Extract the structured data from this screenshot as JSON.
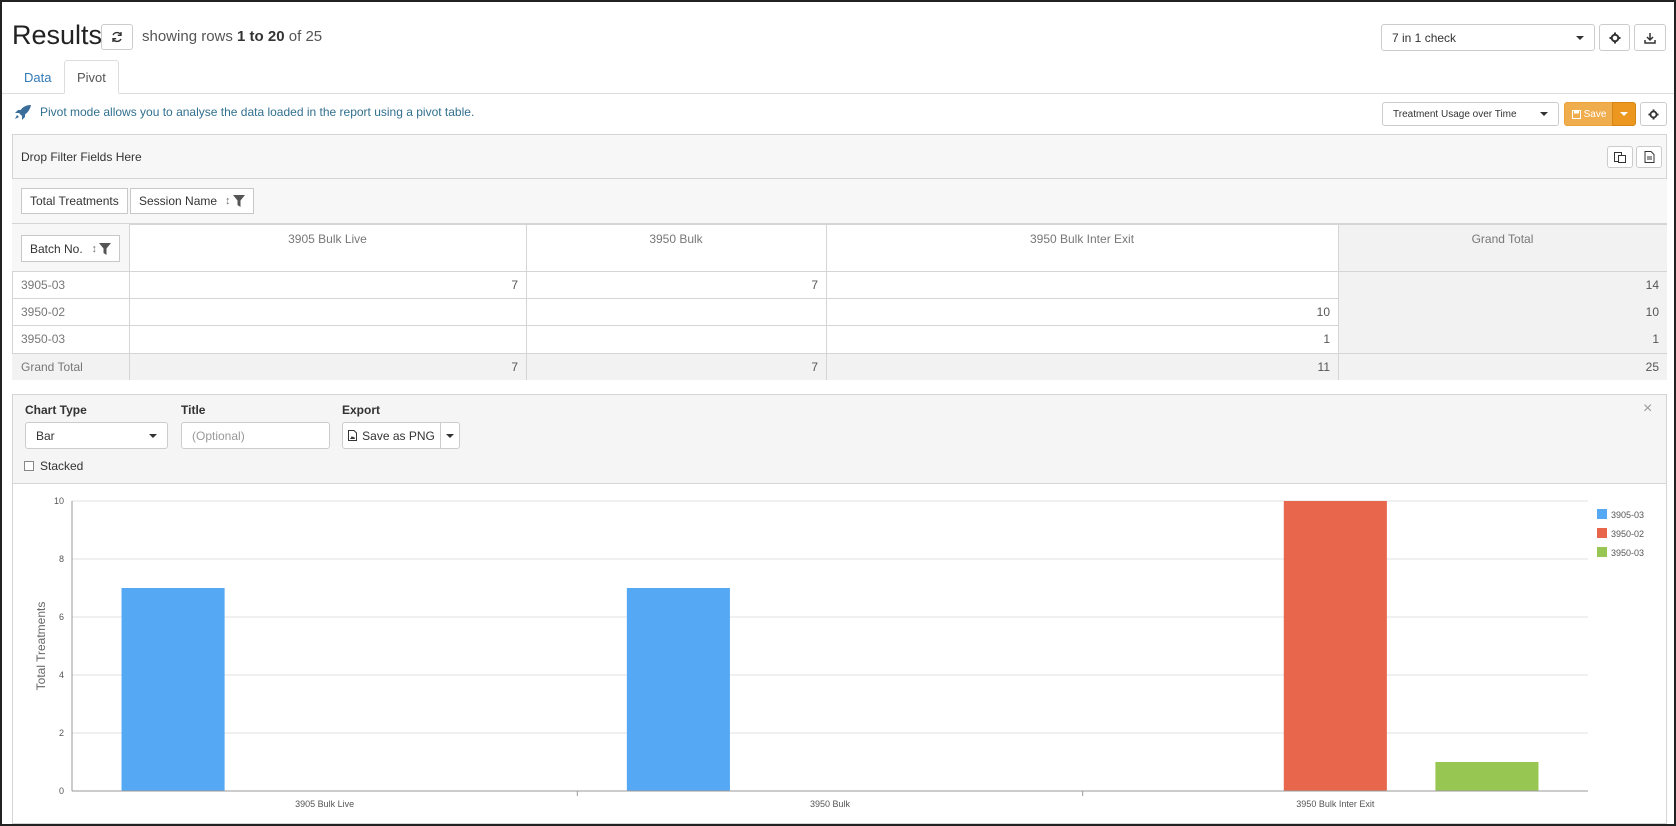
{
  "header": {
    "title": "Results",
    "showing_prefix": "showing rows",
    "showing_range": "1 to 20",
    "showing_of": "of",
    "showing_total": "25",
    "report_select": "7 in 1 check"
  },
  "tabs": [
    {
      "label": "Data",
      "active": false
    },
    {
      "label": "Pivot",
      "active": true
    }
  ],
  "info_text": "Pivot mode allows you to analyse the data loaded in the report using a pivot table.",
  "pivot_select": "Treatment Usage over Time",
  "save_label": "Save",
  "pivot": {
    "filter_placeholder": "Drop Filter Fields Here",
    "value_field": "Total Treatments",
    "column_field": "Session Name",
    "row_field": "Batch No.",
    "columns": [
      "3905 Bulk Live",
      "3950 Bulk",
      "3950 Bulk Inter Exit",
      "Grand Total"
    ],
    "rows": [
      {
        "label": "3905-03",
        "cells": [
          "7",
          "7",
          "",
          "14"
        ]
      },
      {
        "label": "3950-02",
        "cells": [
          "",
          "",
          "10",
          "10"
        ]
      },
      {
        "label": "3950-03",
        "cells": [
          "",
          "",
          "1",
          "1"
        ]
      },
      {
        "label": "Grand Total",
        "cells": [
          "7",
          "7",
          "11",
          "25"
        ]
      }
    ]
  },
  "chart_controls": {
    "chart_type_label": "Chart Type",
    "chart_type_value": "Bar",
    "title_label": "Title",
    "title_placeholder": "(Optional)",
    "export_label": "Export",
    "export_button": "Save as PNG",
    "stacked_label": "Stacked",
    "close_glyph": "×"
  },
  "colors": {
    "3905-03": "#55a9f4",
    "3950-02": "#e8664c",
    "3950-03": "#98c653",
    "accent": "#f0ad4e"
  },
  "chart_data": {
    "type": "bar",
    "categories": [
      "3905 Bulk Live",
      "3950 Bulk",
      "3950 Bulk Inter Exit"
    ],
    "series": [
      {
        "name": "3905-03",
        "values": [
          7,
          7,
          0
        ]
      },
      {
        "name": "3950-02",
        "values": [
          0,
          0,
          10
        ]
      },
      {
        "name": "3950-03",
        "values": [
          0,
          0,
          1
        ]
      }
    ],
    "ylabel": "Total Treatments",
    "xlabel": "",
    "ylim": [
      0,
      10
    ],
    "yticks": [
      0,
      2,
      4,
      6,
      8,
      10
    ],
    "grid": true,
    "legend": "top-right",
    "stacked": false
  }
}
